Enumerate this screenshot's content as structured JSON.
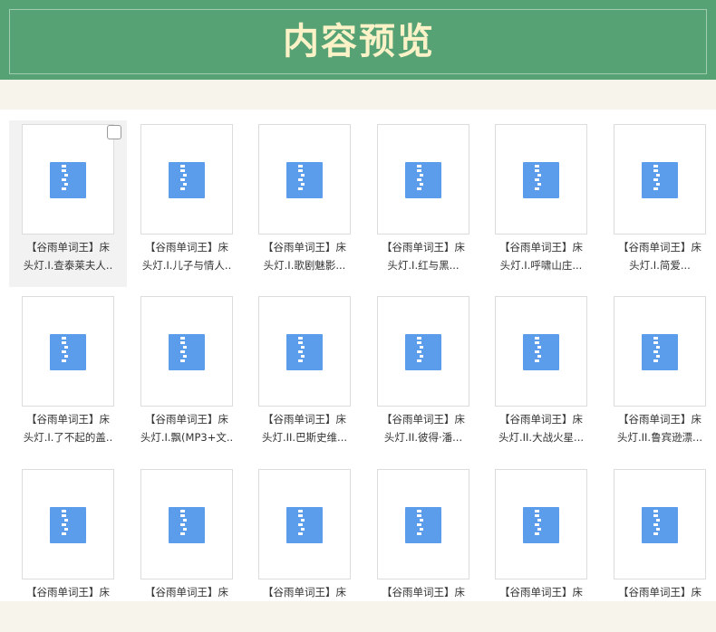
{
  "header": {
    "title": "内容预览"
  },
  "files": [
    {
      "line1": "【谷雨单词王】床",
      "line2": "头灯.I.查泰莱夫人..",
      "selected": true
    },
    {
      "line1": "【谷雨单词王】床",
      "line2": "头灯.I.儿子与情人..",
      "selected": false
    },
    {
      "line1": "【谷雨单词王】床",
      "line2": "头灯.I.歌剧魅影...",
      "selected": false
    },
    {
      "line1": "【谷雨单词王】床",
      "line2": "头灯.I.红与黑...",
      "selected": false
    },
    {
      "line1": "【谷雨单词王】床",
      "line2": "头灯.I.呼啸山庄...",
      "selected": false
    },
    {
      "line1": "【谷雨单词王】床",
      "line2": "头灯.I.简爱...",
      "selected": false
    },
    {
      "line1": "【谷雨单词王】床",
      "line2": "头灯.I.了不起的盖..",
      "selected": false
    },
    {
      "line1": "【谷雨单词王】床",
      "line2": "头灯.I.飘(MP3+文..",
      "selected": false
    },
    {
      "line1": "【谷雨单词王】床",
      "line2": "头灯.II.巴斯史维...",
      "selected": false
    },
    {
      "line1": "【谷雨单词王】床",
      "line2": "头灯.II.彼得·潘...",
      "selected": false
    },
    {
      "line1": "【谷雨单词王】床",
      "line2": "头灯.II.大战火星...",
      "selected": false
    },
    {
      "line1": "【谷雨单词王】床",
      "line2": "头灯.II.鲁宾逊漂...",
      "selected": false
    },
    {
      "line1": "【谷雨单词王】床",
      "line2": "",
      "selected": false
    },
    {
      "line1": "【谷雨单词王】床",
      "line2": "",
      "selected": false
    },
    {
      "line1": "【谷雨单词王】床",
      "line2": "",
      "selected": false
    },
    {
      "line1": "【谷雨单词王】床",
      "line2": "",
      "selected": false
    },
    {
      "line1": "【谷雨单词王】床",
      "line2": "",
      "selected": false
    },
    {
      "line1": "【谷雨单词王】床",
      "line2": "",
      "selected": false
    }
  ]
}
